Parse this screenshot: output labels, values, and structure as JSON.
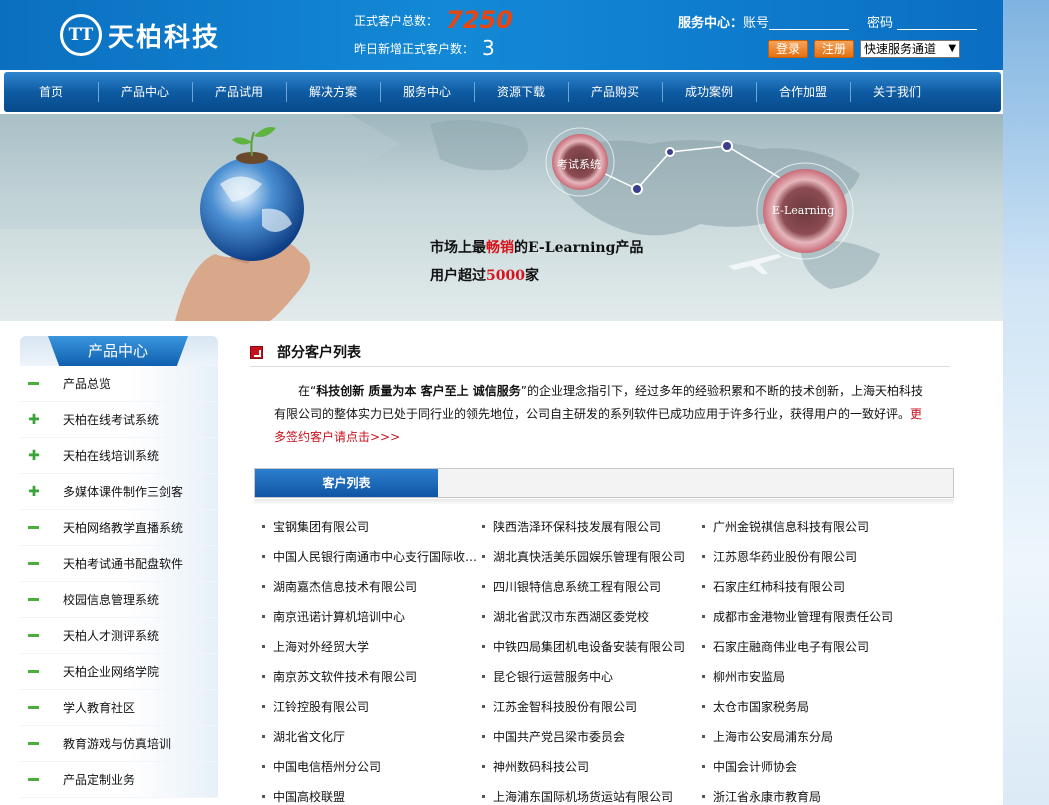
{
  "header": {
    "logo_mark": "TT",
    "logo_text": "天柏科技",
    "stats": {
      "total_label": "正式客户总数：",
      "total_value": "7250",
      "new_label": "昨日新增正式客户数：",
      "new_value": "3"
    },
    "service_center": {
      "title": "服务中心：",
      "account_label": "账号",
      "password_label": "密码",
      "login_label": "登录",
      "register_label": "注册",
      "quick_select": "快速服务通道"
    }
  },
  "nav": [
    "首页",
    "产品中心",
    "产品试用",
    "解决方案",
    "服务中心",
    "资源下载",
    "产品购买",
    "成功案例",
    "合作加盟",
    "关于我们"
  ],
  "banner": {
    "bubble1": "考试系统",
    "bubble2": "E-Learning",
    "line1_pre": "市场上最",
    "line1_em": "畅销",
    "line1_post": "的E-Learning产品",
    "line2_pre": "用户超过",
    "line2_em": "5000",
    "line2_post": "家"
  },
  "sidebar": {
    "title": "产品中心",
    "items": [
      {
        "label": "产品总览",
        "icon": "minus-icon"
      },
      {
        "label": "天柏在线考试系统",
        "icon": "plus-icon"
      },
      {
        "label": "天柏在线培训系统",
        "icon": "plus-icon"
      },
      {
        "label": "多媒体课件制作三剑客",
        "icon": "plus-icon"
      },
      {
        "label": "天柏网络教学直播系统",
        "icon": "minus-icon"
      },
      {
        "label": "天柏考试通书配盘软件",
        "icon": "minus-icon"
      },
      {
        "label": "校园信息管理系统",
        "icon": "minus-icon"
      },
      {
        "label": "天柏人才测评系统",
        "icon": "minus-icon"
      },
      {
        "label": "天柏企业网络学院",
        "icon": "minus-icon"
      },
      {
        "label": "学人教育社区",
        "icon": "minus-icon"
      },
      {
        "label": "教育游戏与仿真培训",
        "icon": "minus-icon"
      },
      {
        "label": "产品定制业务",
        "icon": "minus-icon"
      }
    ]
  },
  "main": {
    "section_title": "部分客户列表",
    "intro_pre": "在“",
    "intro_bold": "科技创新  质量为本  客户至上  诚信服务",
    "intro_post": "”的企业理念指引下，经过多年的经验积累和不断的技术创新，上海天柏科技有限公司的整体实力已处于同行业的领先地位，公司自主研发的系列软件已成功应用于许多行业，获得用户的一致好评。",
    "intro_more": "更多签约客户请点击>>>",
    "list_tab": "客户列表",
    "clients": [
      "宝钢集团有限公司",
      "陕西浩泽环保科技发展有限公司",
      "广州金锐祺信息科技有限公司",
      "中国人民银行南通市中心支行国际收…",
      "湖北真快活美乐园娱乐管理有限公司",
      "江苏恩华药业股份有限公司",
      "湖南嘉杰信息技术有限公司",
      "四川银特信息系统工程有限公司",
      "石家庄红柿科技有限公司",
      "南京迅诺计算机培训中心",
      "湖北省武汉市东西湖区委党校",
      "成都市金港物业管理有限责任公司",
      "上海对外经贸大学",
      "中铁四局集团机电设备安装有限公司",
      "石家庄融商伟业电子有限公司",
      "南京苏文软件技术有限公司",
      "昆仑银行运营服务中心",
      "柳州市安监局",
      "江铃控股有限公司",
      "江苏金智科技股份有限公司",
      "太仓市国家税务局",
      "湖北省文化厅",
      "中国共产党吕梁市委员会",
      "上海市公安局浦东分局",
      "中国电信梧州分公司",
      "神州数码科技公司",
      "中国会计师协会",
      "中国高校联盟",
      "上海浦东国际机场货运站有限公司",
      "浙江省永康市教育局"
    ]
  },
  "colors": {
    "header_blue": "#1389d6",
    "accent_orange": "#e84510",
    "accent_red": "#c8101e",
    "nav_blue": "#0e5ba3"
  }
}
